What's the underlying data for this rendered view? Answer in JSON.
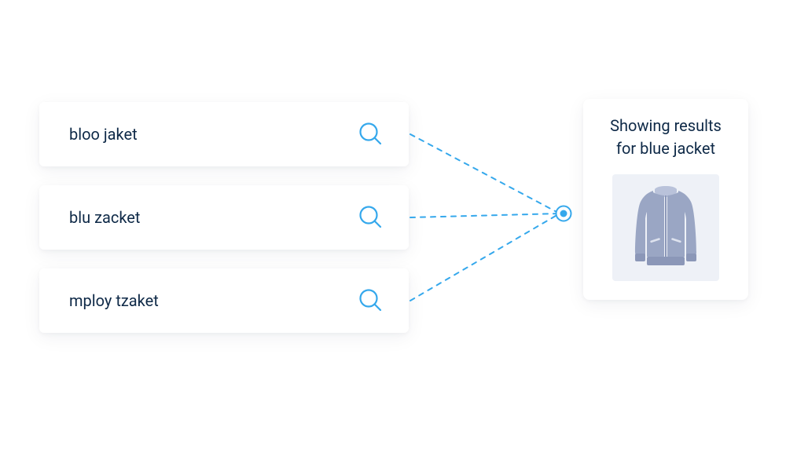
{
  "search_queries": [
    {
      "text": "bloo jaket"
    },
    {
      "text": "blu zacket"
    },
    {
      "text": "mploy tzaket"
    }
  ],
  "result": {
    "heading_line1": "Showing results",
    "heading_line2": "for blue jacket",
    "product_icon": "jacket"
  },
  "colors": {
    "accent": "#35a8ec",
    "text": "#0e2947",
    "product": "#9aa6c4",
    "thumb_bg": "#eef1f7"
  }
}
